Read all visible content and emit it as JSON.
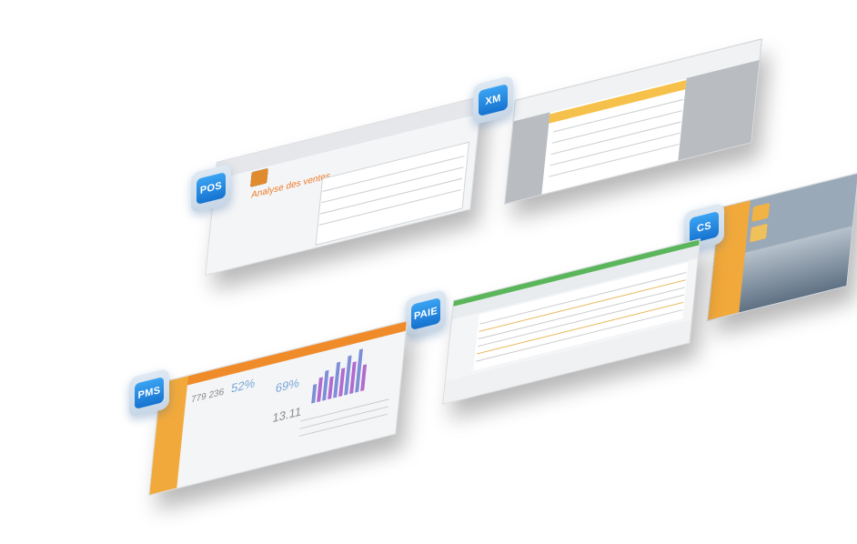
{
  "badges": {
    "pos": "POS",
    "xm": "XM",
    "cs": "CS",
    "paie": "PAIE",
    "pms": "PMS"
  },
  "pos_screen": {
    "heading": "Analyse des ventes"
  },
  "pms_screen": {
    "stat1": "779 236",
    "stat2": "52%",
    "stat3": "69%",
    "stat4": "13.11"
  },
  "colors": {
    "badge_blue": "#1e88e5",
    "orange_accent": "#f0a23a",
    "green_accent": "#5bb55b"
  }
}
